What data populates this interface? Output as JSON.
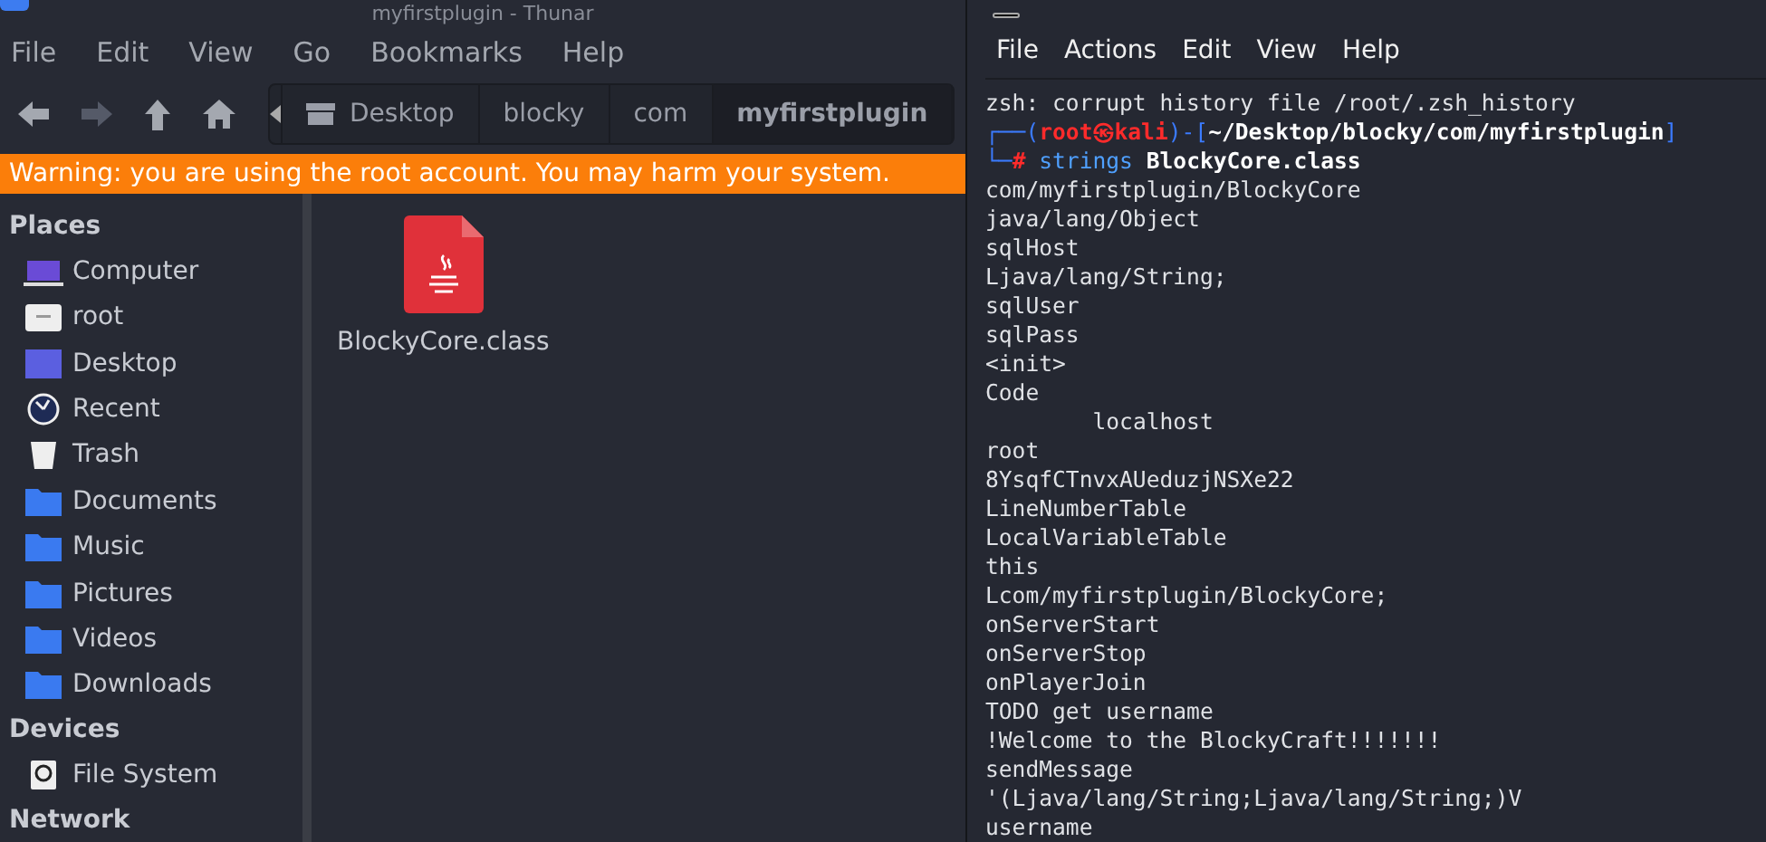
{
  "file_manager": {
    "window_title": "myfirstplugin - Thunar",
    "menu": [
      "File",
      "Edit",
      "View",
      "Go",
      "Bookmarks",
      "Help"
    ],
    "nav_buttons": [
      {
        "kind": "back",
        "disabled": false
      },
      {
        "kind": "forward",
        "disabled": true
      },
      {
        "kind": "up",
        "disabled": false
      },
      {
        "kind": "home",
        "disabled": false
      }
    ],
    "breadcrumb": [
      {
        "label": "Desktop",
        "kind": "place",
        "selected": false
      },
      {
        "label": "blocky",
        "kind": "folder",
        "selected": false
      },
      {
        "label": "com",
        "kind": "folder",
        "selected": false
      },
      {
        "label": "myfirstplugin",
        "kind": "folder",
        "selected": true
      }
    ],
    "warning": "Warning: you are using the root account. You may harm your system.",
    "sidebar": [
      {
        "heading": "Places",
        "items": [
          {
            "label": "Computer",
            "kind": "computer"
          },
          {
            "label": "root",
            "kind": "home"
          },
          {
            "label": "Desktop",
            "kind": "desktop"
          },
          {
            "label": "Recent",
            "kind": "recent"
          },
          {
            "label": "Trash",
            "kind": "trash"
          },
          {
            "label": "Documents",
            "kind": "folder"
          },
          {
            "label": "Music",
            "kind": "folder"
          },
          {
            "label": "Pictures",
            "kind": "folder"
          },
          {
            "label": "Videos",
            "kind": "folder"
          },
          {
            "label": "Downloads",
            "kind": "folder"
          }
        ]
      },
      {
        "heading": "Devices",
        "items": [
          {
            "label": "File System",
            "kind": "drive"
          }
        ]
      },
      {
        "heading": "Network"
      }
    ],
    "files": [
      {
        "name": "BlockyCore.class",
        "kind": "java"
      }
    ]
  },
  "terminal": {
    "menu": [
      "File",
      "Actions",
      "Edit",
      "View",
      "Help"
    ],
    "lines_before": [
      "zsh: corrupt history file /root/.zsh_history"
    ],
    "prompt": {
      "open": "┌──(",
      "user_host": "root㉿kali",
      "mid": ")-[",
      "path": "~/Desktop/blocky/com/myfirstplugin",
      "close": "]",
      "corner": "└─",
      "symbol": "#",
      "command": "strings",
      "argument": "BlockyCore.class"
    },
    "output": [
      "com/myfirstplugin/BlockyCore",
      "java/lang/Object",
      "sqlHost",
      "Ljava/lang/String;",
      "sqlUser",
      "sqlPass",
      "<init>",
      "Code",
      "\tlocalhost",
      "root",
      "8YsqfCTnvxAUeduzjNSXe22",
      "LineNumberTable",
      "LocalVariableTable",
      "this",
      "Lcom/myfirstplugin/BlockyCore;",
      "onServerStart",
      "onServerStop",
      "onPlayerJoin",
      "TODO get username",
      "!Welcome to the BlockyCraft!!!!!!!",
      "sendMessage",
      "'(Ljava/lang/String;Ljava/lang/String;)V",
      "username"
    ]
  }
}
